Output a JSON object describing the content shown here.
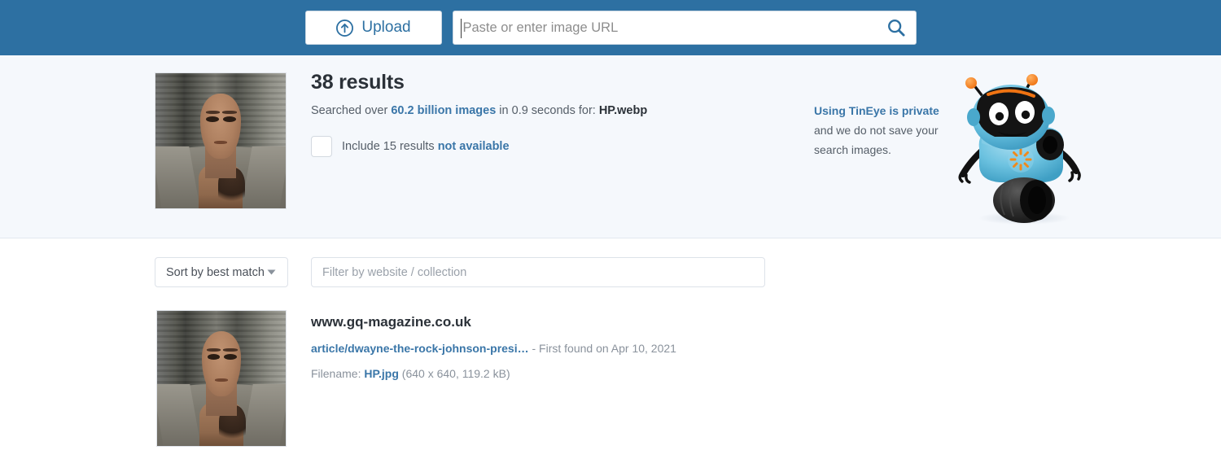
{
  "topbar": {
    "background": "#2d70a2",
    "upload_label": "Upload",
    "upload_icon": "circle-up-arrow-icon",
    "url_placeholder": "Paste or enter image URL",
    "url_value": "",
    "search_icon": "magnifying-glass-icon"
  },
  "summary": {
    "results_count": "38 results",
    "searched_prefix": "Searched over ",
    "searched_images": "60.2 billion images",
    "searched_middle": " in 0.9 seconds for: ",
    "searched_filename": "HP.webp",
    "include_prefix": "Include 15 results ",
    "include_link": "not available",
    "checkbox_checked": false,
    "privacy_link": "Using TinEye is private",
    "privacy_text": "and we do not save your search images.",
    "mascot": "tineye-robot-mascot",
    "query_thumbnail": "query-image-thumbnail"
  },
  "filters": {
    "sort_label": "Sort by best match",
    "sort_icon": "chevron-down-icon",
    "filter_placeholder": "Filter by website / collection",
    "filter_value": ""
  },
  "results": [
    {
      "domain": "www.gq-magazine.co.uk",
      "path": "article/dwayne-the-rock-johnson-presi…",
      "found": " - First found on Apr 10, 2021",
      "filename_label": "Filename: ",
      "filename": "HP.jpg",
      "dimensions": " (640 x 640, 119.2 kB)"
    }
  ],
  "colors": {
    "header_blue": "#2d70a2",
    "band_bg": "#f5f8fc",
    "link_blue": "#3a76a8",
    "text_dark": "#2b3138",
    "text_grey": "#8a929c"
  }
}
